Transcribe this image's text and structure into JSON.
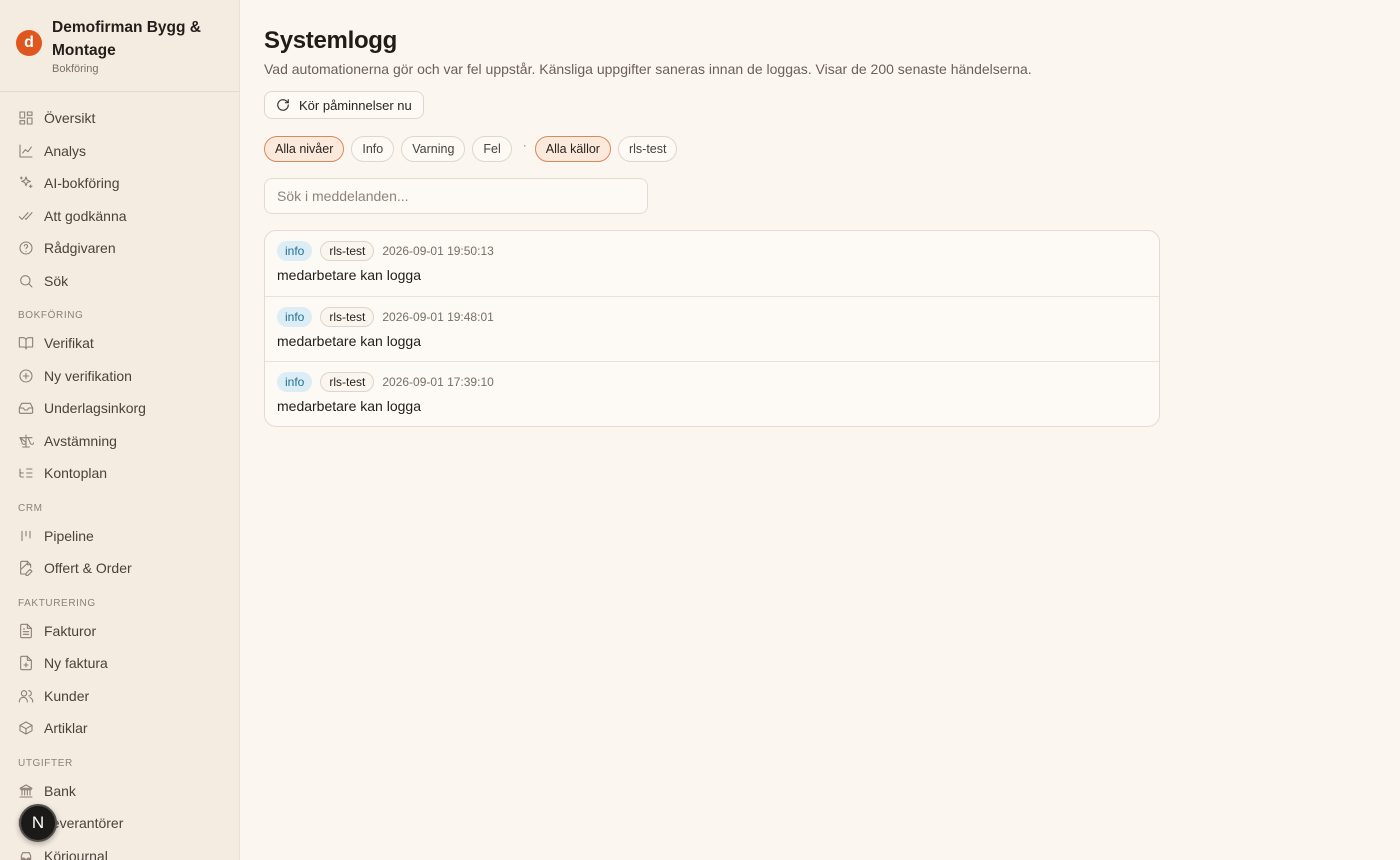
{
  "brand": {
    "logo_letter": "d",
    "name": "Demofirman Bygg & Montage",
    "subtitle": "Bokföring"
  },
  "nav": {
    "top": [
      {
        "label": "Översikt",
        "icon": "grid-icon"
      },
      {
        "label": "Analys",
        "icon": "chart-line-icon"
      },
      {
        "label": "AI-bokföring",
        "icon": "sparkles-icon"
      },
      {
        "label": "Att godkänna",
        "icon": "double-check-icon"
      },
      {
        "label": "Rådgivaren",
        "icon": "help-circle-icon"
      },
      {
        "label": "Sök",
        "icon": "search-icon"
      }
    ],
    "sections": [
      {
        "title": "BOKFÖRING",
        "items": [
          {
            "label": "Verifikat",
            "icon": "book-open-icon"
          },
          {
            "label": "Ny verifikation",
            "icon": "plus-circle-icon"
          },
          {
            "label": "Underlagsinkorg",
            "icon": "inbox-icon"
          },
          {
            "label": "Avstämning",
            "icon": "scale-icon"
          },
          {
            "label": "Kontoplan",
            "icon": "list-tree-icon"
          }
        ]
      },
      {
        "title": "CRM",
        "items": [
          {
            "label": "Pipeline",
            "icon": "kanban-icon"
          },
          {
            "label": "Offert & Order",
            "icon": "file-edit-icon"
          }
        ]
      },
      {
        "title": "FAKTURERING",
        "items": [
          {
            "label": "Fakturor",
            "icon": "file-text-icon"
          },
          {
            "label": "Ny faktura",
            "icon": "file-plus-icon"
          },
          {
            "label": "Kunder",
            "icon": "users-icon"
          },
          {
            "label": "Artiklar",
            "icon": "package-icon"
          }
        ]
      },
      {
        "title": "UTGIFTER",
        "items": [
          {
            "label": "Bank",
            "icon": "bank-icon"
          },
          {
            "label": "Leverantörer",
            "icon": "truck-icon"
          },
          {
            "label": "Körjournal",
            "icon": "car-icon"
          }
        ]
      }
    ]
  },
  "nextjs_badge": "N",
  "page": {
    "title": "Systemlogg",
    "description": "Vad automationerna gör och var fel uppstår. Känsliga uppgifter saneras innan de loggas. Visar de 200 senaste händelserna.",
    "run_button": "Kör påminnelser nu"
  },
  "filters": {
    "levels": [
      {
        "label": "Alla nivåer",
        "active": true
      },
      {
        "label": "Info",
        "active": false
      },
      {
        "label": "Varning",
        "active": false
      },
      {
        "label": "Fel",
        "active": false
      }
    ],
    "separator": "·",
    "sources": [
      {
        "label": "Alla källor",
        "active": true
      },
      {
        "label": "rls-test",
        "active": false
      }
    ]
  },
  "search": {
    "placeholder": "Sök i meddelanden...",
    "value": ""
  },
  "logs": [
    {
      "level": "info",
      "source": "rls-test",
      "time": "2026-09-01 19:50:13",
      "message": "medarbetare kan logga"
    },
    {
      "level": "info",
      "source": "rls-test",
      "time": "2026-09-01 19:48:01",
      "message": "medarbetare kan logga"
    },
    {
      "level": "info",
      "source": "rls-test",
      "time": "2026-09-01 17:39:10",
      "message": "medarbetare kan logga"
    }
  ],
  "colors": {
    "accent": "#e0561f",
    "info_badge": "#dcedf5",
    "background": "#fcf6f0",
    "sidebar": "#f4ebe1"
  }
}
